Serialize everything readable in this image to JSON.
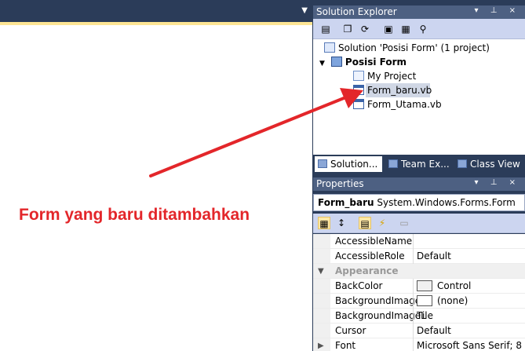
{
  "editor": {
    "annotation": "Form yang baru ditambahkan"
  },
  "solution_explorer": {
    "title": "Solution Explorer",
    "tree": [
      {
        "label": "Solution 'Posisi Form' (1 project)"
      },
      {
        "label": "Posisi Form",
        "bold": true,
        "expanded": true
      },
      {
        "label": "My Project"
      },
      {
        "label": "Form_baru.vb",
        "selected": true
      },
      {
        "label": "Form_Utama.vb"
      }
    ],
    "tabs": [
      "Solution...",
      "Team Ex...",
      "Class View"
    ]
  },
  "properties": {
    "title": "Properties",
    "object_name": "Form_baru",
    "object_type": "System.Windows.Forms.Form",
    "rows": [
      {
        "name": "AccessibleName",
        "value": ""
      },
      {
        "name": "AccessibleRole",
        "value": "Default"
      },
      {
        "name": "Appearance",
        "category": true
      },
      {
        "name": "BackColor",
        "value": "Control",
        "swatch": "#f0f0f0"
      },
      {
        "name": "BackgroundImage",
        "value": "(none)",
        "swatch": "#ffffff"
      },
      {
        "name": "BackgroundImageL",
        "value": "Tile"
      },
      {
        "name": "Cursor",
        "value": "Default"
      },
      {
        "name": "Font",
        "value": "Microsoft Sans Serif; 8"
      }
    ]
  },
  "colors": {
    "accent": "#e3262a",
    "chrome": "#2b3c59",
    "highlight": "#fde594"
  }
}
